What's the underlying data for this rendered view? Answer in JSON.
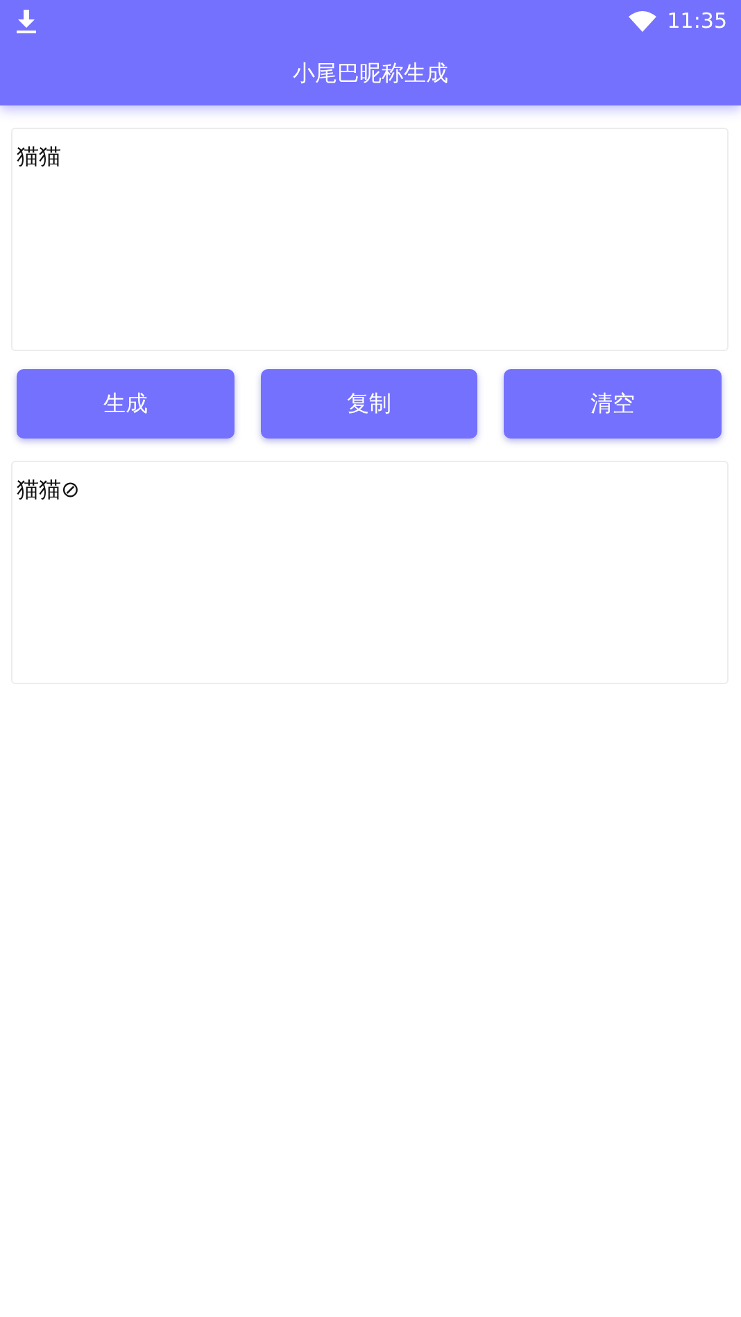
{
  "status_bar": {
    "time": "11:35"
  },
  "app_bar": {
    "title": "小尾巴昵称生成"
  },
  "input": {
    "value": "猫猫"
  },
  "buttons": [
    {
      "label": "生成"
    },
    {
      "label": "复制"
    },
    {
      "label": "清空"
    }
  ],
  "output": {
    "value": "猫猫⊘"
  }
}
